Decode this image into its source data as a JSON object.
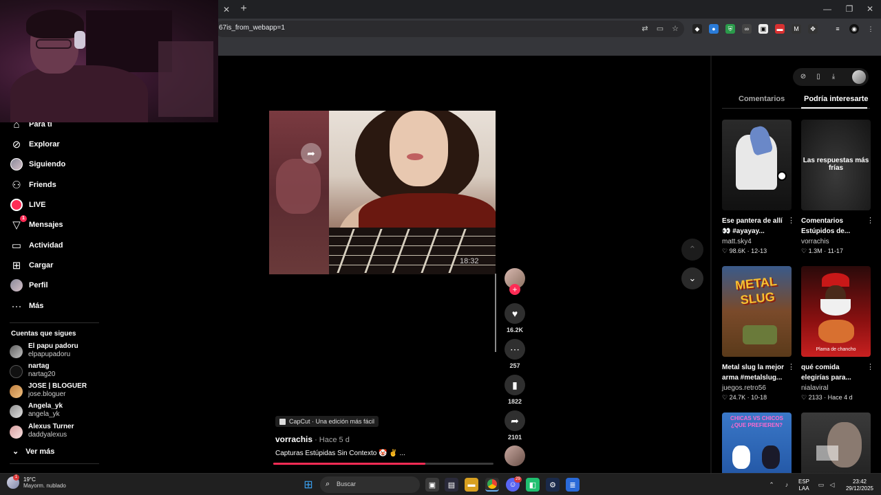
{
  "browser": {
    "url": "67is_from_webapp=1",
    "tab_close": "✕",
    "tab_new": "+",
    "window_controls": [
      "—",
      "❐",
      "✕"
    ]
  },
  "sidebar": {
    "items": [
      {
        "label": "Para ti",
        "icon": "home-icon"
      },
      {
        "label": "Explorar",
        "icon": "compass-icon"
      },
      {
        "label": "Siguiendo",
        "icon": "following-avatar"
      },
      {
        "label": "Friends",
        "icon": "friends-icon"
      },
      {
        "label": "LIVE",
        "icon": "live-icon"
      },
      {
        "label": "Mensajes",
        "icon": "messages-icon",
        "badge": "1"
      },
      {
        "label": "Actividad",
        "icon": "activity-icon"
      },
      {
        "label": "Cargar",
        "icon": "upload-icon"
      },
      {
        "label": "Perfil",
        "icon": "profile-avatar"
      },
      {
        "label": "Más",
        "icon": "more-dots-icon"
      }
    ],
    "following_title": "Cuentas que sigues",
    "following": [
      {
        "name": "El papu padoru",
        "handle": "elpapupadoru"
      },
      {
        "name": "nartag",
        "handle": "nartag20"
      },
      {
        "name": "JOSE | BLOGUER",
        "handle": "jose.bloguer"
      },
      {
        "name": "Angela_yk",
        "handle": "angela_yk"
      },
      {
        "name": "Alexus Turner",
        "handle": "daddyalexus"
      }
    ],
    "see_more": "Ver más"
  },
  "video": {
    "timestamp_overlay": "18:32",
    "capcut_label": "CapCut · Una edición más fácil",
    "author": "vorrachis",
    "posted": " · Hace 5 d",
    "caption": "Capturas Estúpidas Sin Contexto 🤡 ✌️ ...",
    "progress": 0.69
  },
  "actions": {
    "likes": "16.2K",
    "comments": "257",
    "saves": "1822",
    "shares": "2101"
  },
  "right_panel": {
    "tabs": [
      "Comentarios",
      "Podría interesarte"
    ],
    "active_tab": 1,
    "cards": [
      {
        "title": "Ese pantera de allí 👀 #ayayay...",
        "author": "matt.sky4",
        "likes": "98.6K",
        "date": "12-13",
        "thumb_text": ""
      },
      {
        "title": "Comentarios Estúpidos de...",
        "author": "vorrachis",
        "likes": "1.3M",
        "date": "11-17",
        "thumb_text": "Las respuestas más frías"
      },
      {
        "title": "Metal slug la mejor arma #metalslug...",
        "author": "juegos.retro56",
        "likes": "24.7K",
        "date": "10-18",
        "thumb_text": "METAL SLUG"
      },
      {
        "title": "qué comida elegirías para...",
        "author": "nialaviral",
        "likes": "2133",
        "date": "Hace 4 d",
        "thumb_text": "Plama de chancho"
      },
      {
        "title": "",
        "author": "",
        "likes": "",
        "date": "",
        "thumb_text": "CHICAS VS CHICOS ¿QUE PREFIEREN?"
      },
      {
        "title": "",
        "author": "",
        "likes": "",
        "date": "",
        "thumb_text": ""
      }
    ]
  },
  "taskbar": {
    "temperature": "19°C",
    "weather": "Mayorm. nublado",
    "weather_badge": "1",
    "search_placeholder": "Buscar",
    "language": "ESP",
    "layout": "LAA",
    "time": "23:42",
    "date": "29/12/2025",
    "discord_badge": "29"
  },
  "colors": {
    "accent": "#fe2c55",
    "background": "#000000",
    "chrome": "#35363a"
  }
}
